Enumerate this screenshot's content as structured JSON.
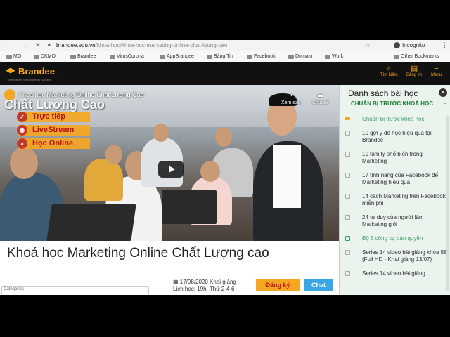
{
  "browser": {
    "url_domain": "brandee.edu.vn",
    "url_path": "/khoa-hoc/khoa-hoc-marketing-online-chat-luong-cao",
    "incognito_label": "Incognito",
    "bookmarks": [
      "MO",
      "DKMO",
      "Brandee",
      "VirusCorona",
      "AppBrandee",
      "Bảng Tin",
      "Facebook",
      "Domain",
      "Work"
    ],
    "other_bookmarks": "Other Bookmarks"
  },
  "site": {
    "logo": "Brandee",
    "tagline": "Your Partner for Marketing Success",
    "search_label": "Tìm kiếm",
    "news_label": "Bảng tin",
    "menu_label": "Menu"
  },
  "video": {
    "overlay_title": "Khóa học Marketing Online Chất Lượng Cao",
    "big_title": "Chất Lượng Cao",
    "tags": [
      "Trực tiếp",
      "LiveStream",
      "Học Online"
    ],
    "watch_later": "Xem sau",
    "share": "Chia sẻ"
  },
  "course": {
    "title": "Khoá học Marketing Online Chất Lượng cao",
    "date": "17/08/2020 Khai giảng",
    "schedule": "Lịch học: 19h, Thứ 2-4-6",
    "register_button": "Đăng ký",
    "chat_button": "Chat",
    "chip": "Categories"
  },
  "sidebar": {
    "title": "Danh sách bài học",
    "section": "CHUẨN BỊ TRƯỚC KHOÁ HỌC",
    "items": [
      {
        "label": "Chuẩn bị trước khoá học",
        "state": "current"
      },
      {
        "label": "10 gợi ý để học hiệu quả tại Brandee",
        "state": ""
      },
      {
        "label": "10 tâm lý phổ biến trong Marketing",
        "state": ""
      },
      {
        "label": "17 tính năng của Facebook để Marketing hiệu quả",
        "state": ""
      },
      {
        "label": "14 cách Marketing trên Facebook miễn phí",
        "state": ""
      },
      {
        "label": "24 tư duy của người làm Marketing giỏi",
        "state": ""
      },
      {
        "label": "Bộ 5 công cụ bản quyền",
        "state": "section"
      },
      {
        "label": "Series 14 video bài giảng khóa 58 (Full HD - Khai giảng 13/07)",
        "state": ""
      },
      {
        "label": "Series 14 video bài giảng",
        "state": ""
      }
    ]
  },
  "colors": {
    "accent": "#f5a623",
    "green": "#3fa06b",
    "header_bg": "#111111"
  }
}
